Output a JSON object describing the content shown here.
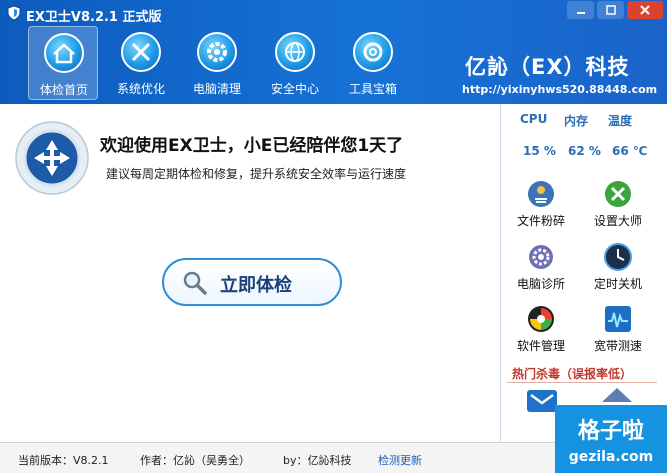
{
  "window": {
    "title": "EX卫士V8.2.1 正式版"
  },
  "nav": [
    {
      "label": "体检首页",
      "icon": "home-icon"
    },
    {
      "label": "系统优化",
      "icon": "tools-icon"
    },
    {
      "label": "电脑清理",
      "icon": "gear-icon"
    },
    {
      "label": "安全中心",
      "icon": "globe-icon"
    },
    {
      "label": "工具宝箱",
      "icon": "toolbox-icon"
    }
  ],
  "brand": {
    "name": "亿訫（EX）科技",
    "url": "http://yixinyhws520.88448.com"
  },
  "main": {
    "welcome": "欢迎使用EX卫士，小E已经陪伴您1天了",
    "tip": "建议每周定期体检和修复，提升系统安全效率与运行速度",
    "check_button": "立即体检"
  },
  "stats": {
    "headers": [
      "CPU",
      "内存",
      "温度"
    ],
    "values": [
      "15 %",
      "62 %",
      "66 ℃"
    ]
  },
  "tools": [
    {
      "label": "文件粉碎",
      "icon": "shred-icon"
    },
    {
      "label": "设置大师",
      "icon": "settings-master-icon"
    },
    {
      "label": "电脑诊所",
      "icon": "gear-icon"
    },
    {
      "label": "定时关机",
      "icon": "clock-icon"
    },
    {
      "label": "软件管理",
      "icon": "software-icon"
    },
    {
      "label": "宽带测速",
      "icon": "speedtest-icon"
    }
  ],
  "hot": {
    "title": "热门杀毒（误报率低）"
  },
  "status": {
    "version": "当前版本：V8.2.1",
    "author": "作者：亿訫（吴勇全）",
    "by": "by：亿訫科技",
    "update": "检测更新"
  },
  "watermark": {
    "line1": "格子啦",
    "line2": "gezila.com"
  },
  "colors": {
    "header": "#1672d6",
    "accent": "#2a6db8",
    "hot": "#c0392b"
  }
}
